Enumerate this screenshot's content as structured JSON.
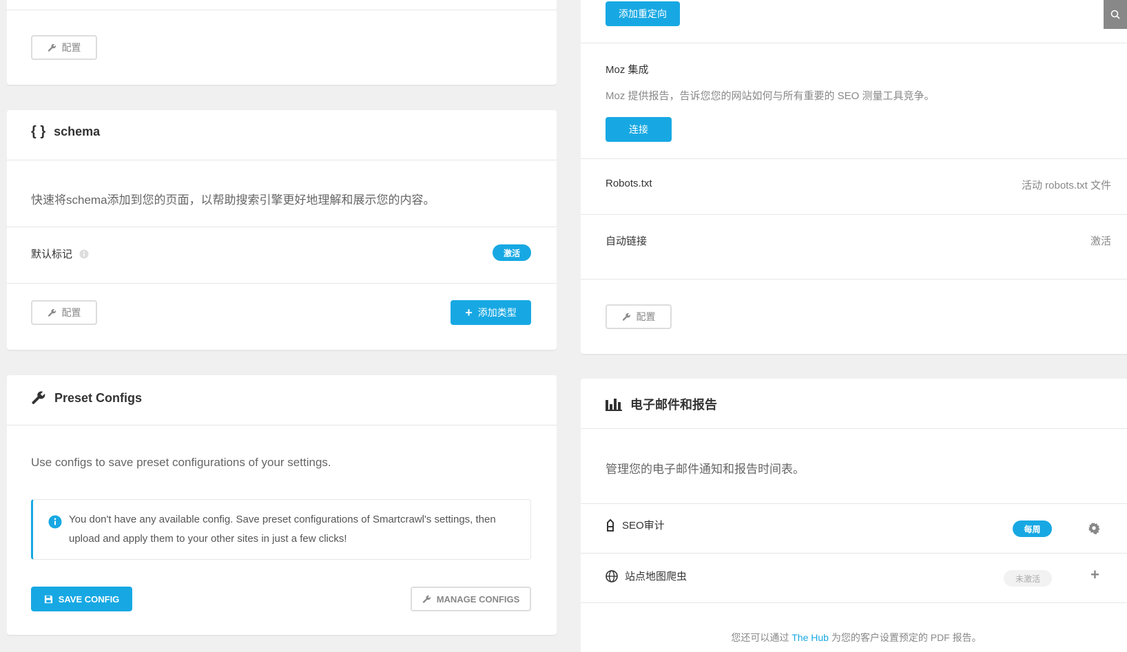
{
  "left": {
    "top_card": {
      "configure_label": "配置"
    },
    "schema": {
      "title": "schema",
      "title_icon": "{ }",
      "description": "快速将schema添加到您的页面，以帮助搜索引擎更好地理解和展示您的内容。",
      "default_markup_label": "默认标记",
      "default_markup_status": "激活",
      "configure_label": "配置",
      "add_type_label": "添加类型"
    },
    "preset_configs": {
      "title": "Preset Configs",
      "description": "Use configs to save preset configurations of your settings.",
      "notice_line1": "You don't have any available config. Save preset configurations of Smartcrawl's settings, then",
      "notice_line2": "upload and apply them to your other sites in just a few clicks!",
      "save_label": "SAVE CONFIG",
      "manage_label": "MANAGE CONFIGS"
    }
  },
  "right": {
    "advanced": {
      "add_redirect_label": "添加重定向",
      "moz_title": "Moz 集成",
      "moz_description": "Moz 提供报告，告诉您您的网站如何与所有重要的 SEO 测量工具竞争。",
      "connect_label": "连接",
      "robots_label": "Robots.txt",
      "robots_status": "活动 robots.txt 文件",
      "autolinks_label": "自动链接",
      "autolinks_status": "激活",
      "configure_label": "配置"
    },
    "reports": {
      "title": "电子邮件和报告",
      "description": "管理您的电子邮件通知和报告时间表。",
      "seo_audit_label": "SEO审计",
      "seo_audit_status": "每周",
      "sitemap_crawler_label": "站点地图爬虫",
      "sitemap_crawler_status": "未激活",
      "footer_prefix": "您还可以通过 ",
      "footer_link": "The Hub",
      "footer_suffix": " 为您的客户设置预定的 PDF 报告。"
    }
  },
  "colors": {
    "accent": "#17a8e3",
    "background": "#f0f0f0",
    "card": "#ffffff"
  }
}
